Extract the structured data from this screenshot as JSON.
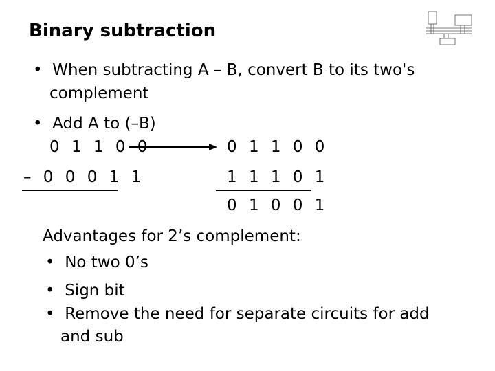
{
  "title": "Binary subtraction",
  "bullets": [
    "When subtracting A – B, convert B to its two's",
    "complement",
    "Add A to (–B)"
  ],
  "bullet_char": "•",
  "left": {
    "a": "0 1 1 0 0",
    "b": "– 0 0 0 1 1"
  },
  "right": {
    "a": "0 1 1 0 0",
    "b": "1 1 1 0 1",
    "result": "0 1 0 0 1"
  },
  "advantages": {
    "heading": "Advantages for 2’s complement:",
    "items": [
      "No two 0’s",
      "Sign bit",
      "Remove the need for separate circuits for add",
      "and sub"
    ]
  },
  "icons": {
    "arrow": "right-arrow",
    "diagram": "computer-bus-diagram"
  }
}
